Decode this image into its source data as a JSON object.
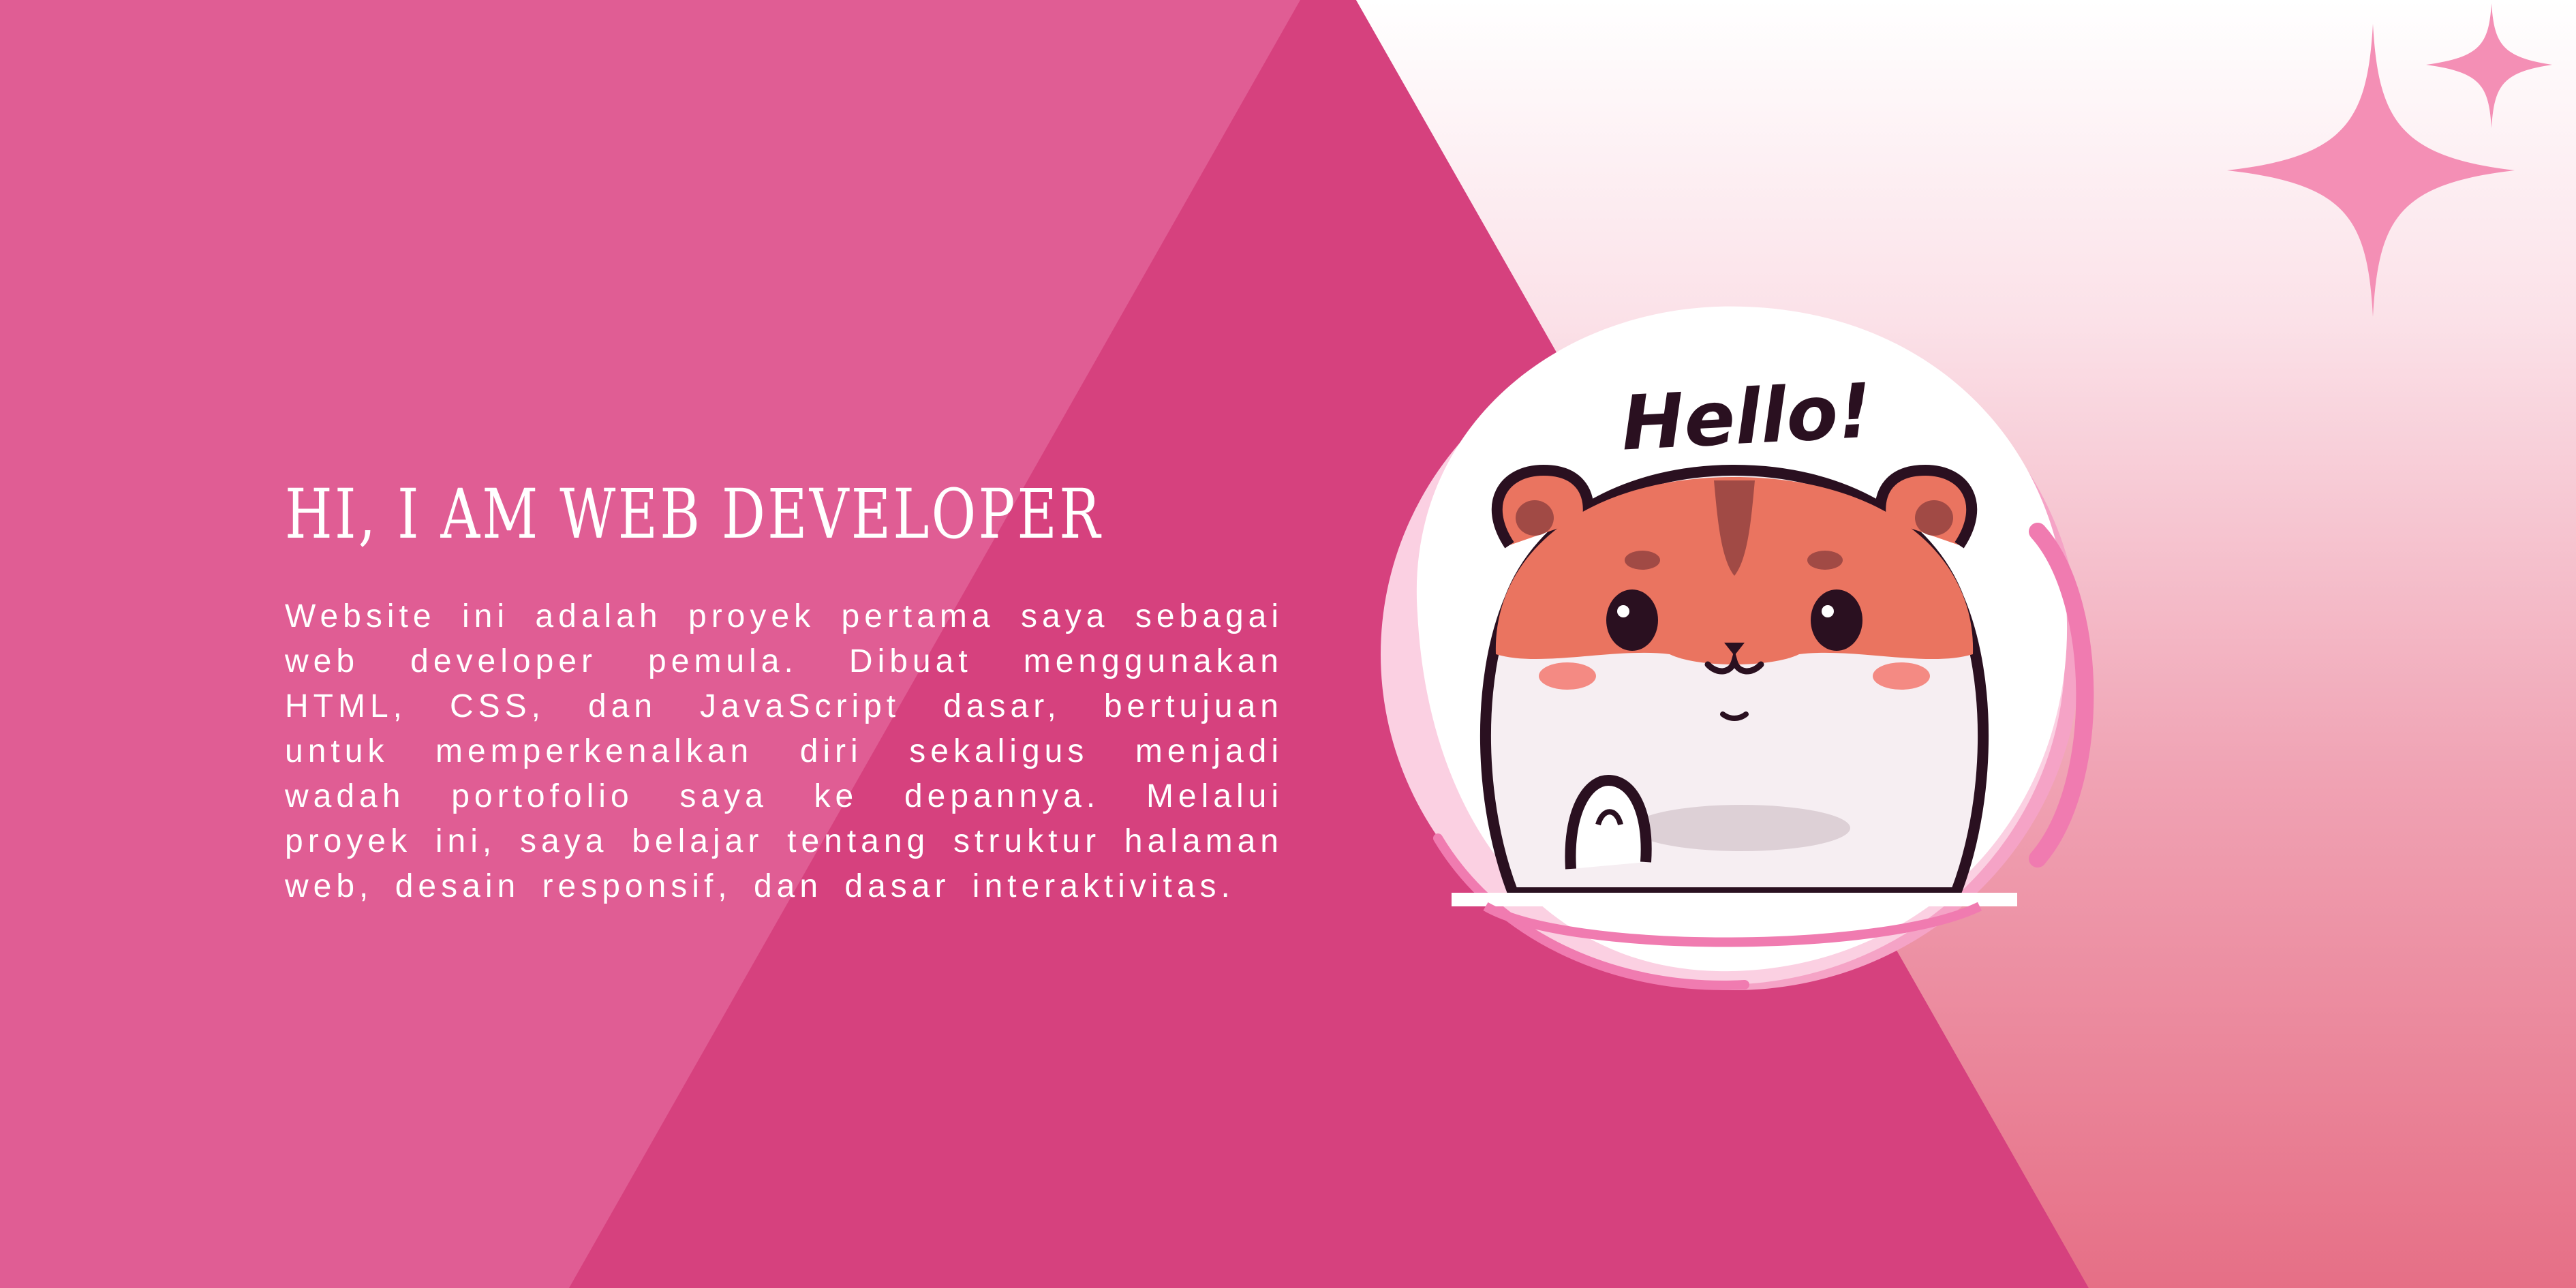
{
  "hero": {
    "title": "HI, I AM WEB DEVELOPER",
    "description": "Website ini adalah proyek pertama saya sebagai web developer pemula. Dibuat menggunakan HTML, CSS, dan JavaScript dasar, bertujuan untuk memperkenalkan diri sekaligus menjadi wadah portofolio saya ke depannya. Melalui proyek ini, saya belajar tentang struktur halaman web, desain responsif, dan dasar interaktivitas."
  },
  "mascot": {
    "greeting": "Hello!",
    "icon": "hamster-icon"
  },
  "decorations": {
    "icons": [
      "sparkle-icon",
      "sparkle-small-icon"
    ]
  },
  "colors": {
    "left_panel": "#e05d94",
    "center_triangle": "#d6417e",
    "right_gradient_top": "#ffffff",
    "right_gradient_bottom": "#e66f86",
    "sparkle": "#f48fb5",
    "hamster_orange": "#ea7460",
    "hamster_outline": "#2a1020"
  }
}
